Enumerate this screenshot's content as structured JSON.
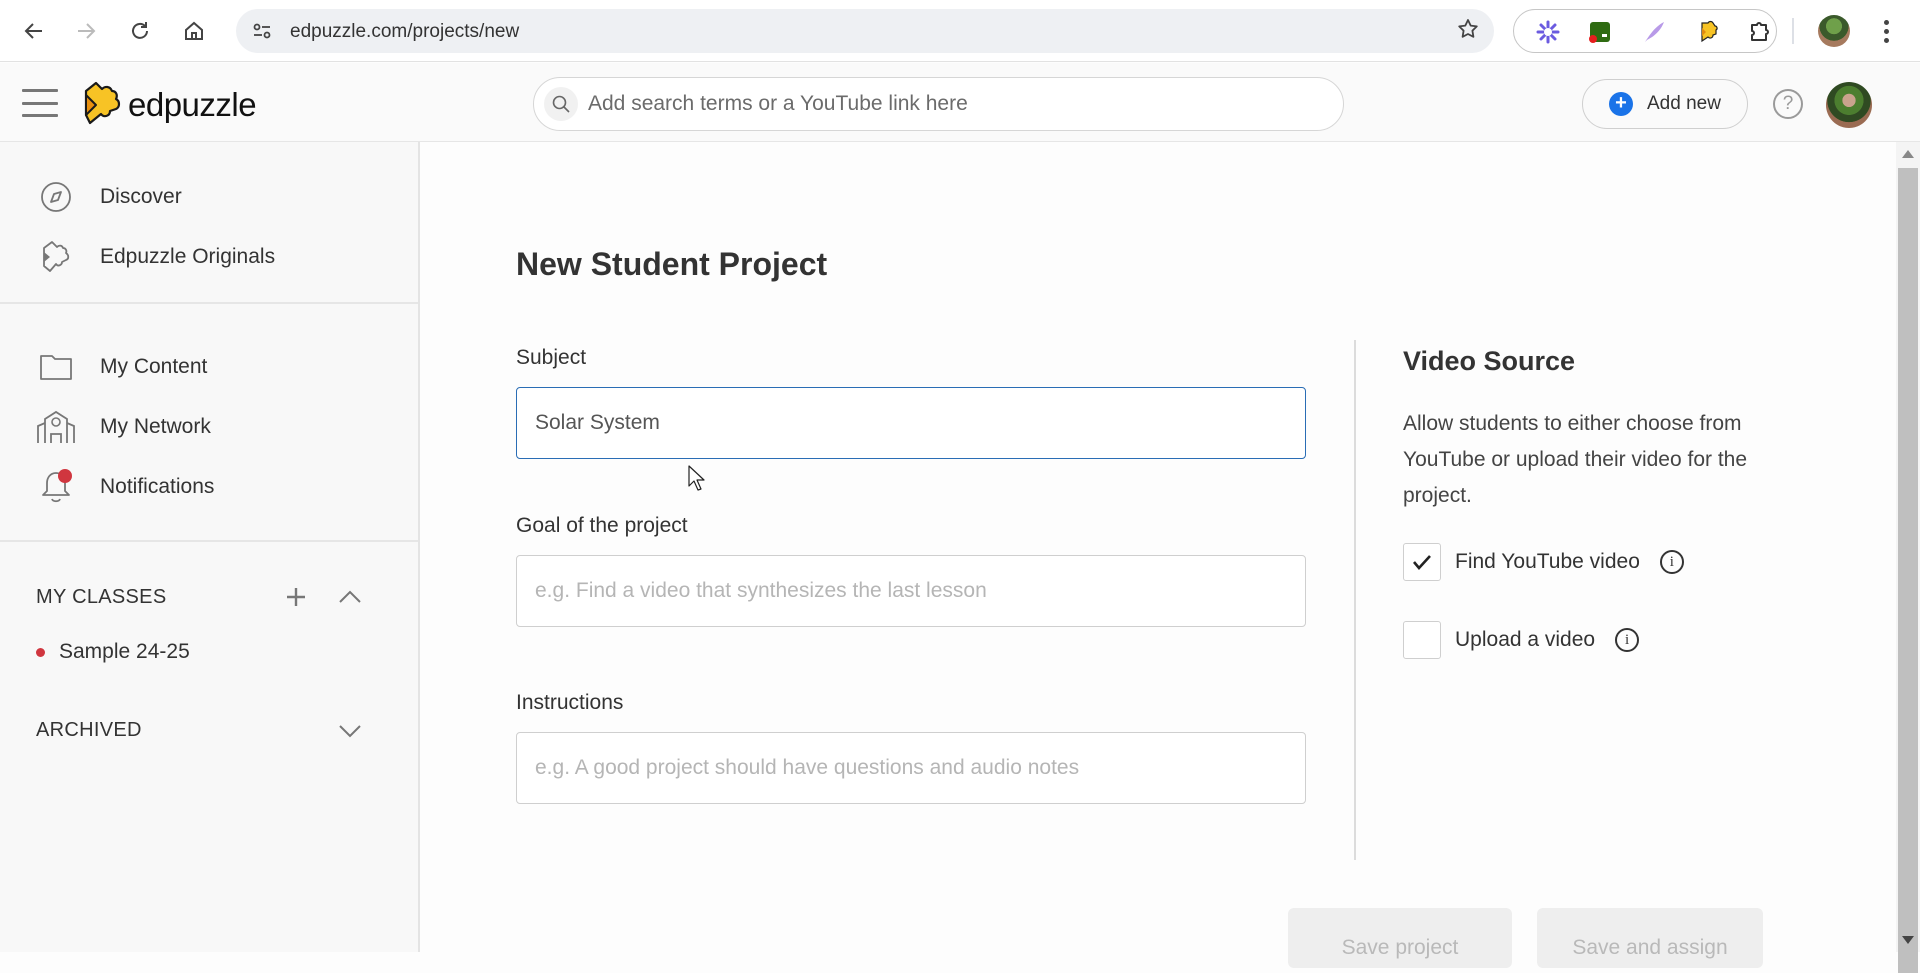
{
  "browser": {
    "url": "edpuzzle.com/projects/new",
    "back_label": "Back",
    "forward_label": "Forward",
    "reload_label": "Reload",
    "home_label": "Home",
    "extensions": [
      "asterisk-extension",
      "screen-recorder-extension",
      "feather-extension",
      "edpuzzle-extension",
      "extensions-puzzle"
    ]
  },
  "header": {
    "logo_text": "edpuzzle",
    "search_placeholder": "Add search terms or a YouTube link here",
    "add_new_label": "Add new",
    "help_label": "?"
  },
  "sidebar": {
    "primary": [
      {
        "label": "Discover",
        "icon": "compass-icon"
      },
      {
        "label": "Edpuzzle Originals",
        "icon": "puzzle-icon"
      }
    ],
    "secondary": [
      {
        "label": "My Content",
        "icon": "folder-icon"
      },
      {
        "label": "My Network",
        "icon": "school-icon"
      },
      {
        "label": "Notifications",
        "icon": "bell-icon",
        "has_badge": true
      }
    ],
    "my_classes_label": "MY CLASSES",
    "classes": [
      {
        "label": "Sample 24-25",
        "color": "#d0363f"
      }
    ],
    "archived_label": "ARCHIVED"
  },
  "form": {
    "title": "New Student Project",
    "subject": {
      "label": "Subject",
      "value": "Solar System"
    },
    "goal": {
      "label": "Goal of the project",
      "value": "",
      "placeholder": "e.g. Find a video that synthesizes the last lesson"
    },
    "instructions": {
      "label": "Instructions",
      "value": "",
      "placeholder": "e.g. A good project should have questions and audio notes"
    },
    "save_project_label": "Save project",
    "save_assign_label": "Save and assign"
  },
  "video_source": {
    "title": "Video Source",
    "description": "Allow students to either choose from YouTube or upload their video for the project.",
    "options": [
      {
        "label": "Find YouTube video",
        "checked": true
      },
      {
        "label": "Upload a video",
        "checked": false
      }
    ],
    "info_glyph": "i"
  },
  "colors": {
    "accent_blue": "#1a73e8",
    "focus_border": "#2a6db5",
    "badge_red": "#d0363f",
    "logo_yellow": "#f7c325"
  }
}
